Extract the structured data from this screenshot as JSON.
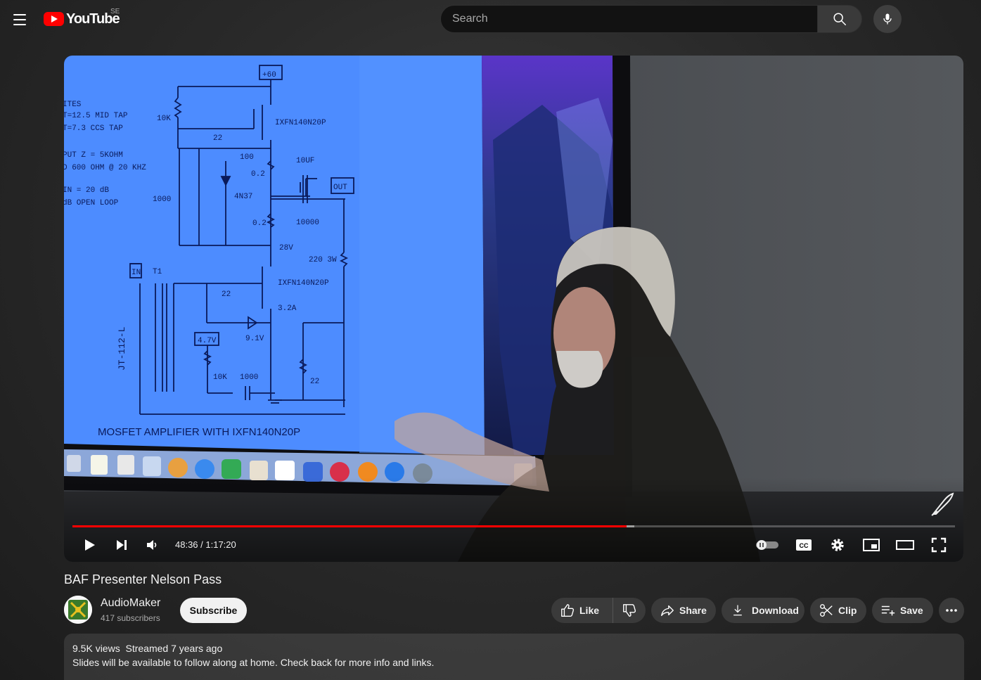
{
  "header": {
    "logo_text": "YouTube",
    "country_code": "SE",
    "search_placeholder": "Search"
  },
  "player": {
    "current_time": "48:36",
    "duration": "1:17:20",
    "time_display": "48:36 / 1:17:20",
    "progress_fraction": 0.628,
    "buffered_fraction": 0.637,
    "cc_label": "CC",
    "slide": {
      "supply": "+60",
      "notes": [
        "ITES",
        "T=12.5 MID TAP",
        "T=7.3 CCS TAP",
        "PUT Z = 5KOHM",
        "D 600 OHM @ 20 KHZ",
        "IN = 20 dB",
        "dB OPEN LOOP"
      ],
      "labels": {
        "r10k_top": "10K",
        "r22_top": "22",
        "mosfet_top": "IXFN140N20P",
        "r100": "100",
        "r02_a": "0.2",
        "c10uf": "10UF",
        "out": "OUT",
        "c1000_left": "1000",
        "opto": "4N37",
        "r02_b": "0.2",
        "c10000": "10000",
        "v28": "28V",
        "r220": "220 3W",
        "in": "IN",
        "t1": "T1",
        "mosfet_bottom": "IXFN140N20P",
        "r22_mid": "22",
        "i32": "3.2A",
        "transformer": "JT-112-L",
        "v47": "4.7V",
        "z91": "9.1V",
        "r10k_bottom": "10K",
        "c1000_bottom": "1000",
        "r22_bottom": "22",
        "caption": "MOSFET AMPLIFIER WITH IXFN140N20P"
      }
    }
  },
  "video": {
    "title": "BAF Presenter Nelson Pass"
  },
  "channel": {
    "name": "AudioMaker",
    "subscribers": "417 subscribers",
    "subscribe_label": "Subscribe"
  },
  "actions": {
    "like": "Like",
    "share": "Share",
    "download": "Download",
    "clip": "Clip",
    "save": "Save"
  },
  "description": {
    "views": "9.5K views",
    "streamed": "Streamed 7 years ago",
    "text": "Slides will be available to follow along at home.  Check back for more info and links."
  },
  "colors": {
    "progress": "#ff0000",
    "brand": "#ff0000",
    "slide_bg": "#4d8cff"
  }
}
